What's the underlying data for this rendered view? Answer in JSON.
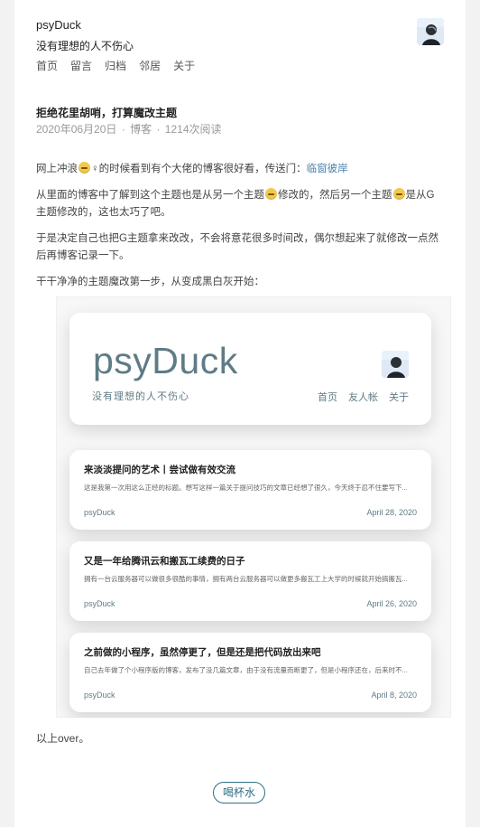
{
  "site": {
    "title": "psyDuck",
    "description": "没有理想的人不伤心",
    "nav": [
      "首页",
      "留言",
      "归档",
      "邻居",
      "关于"
    ]
  },
  "post": {
    "title": "拒绝花里胡哨，打算魔改主题",
    "date": "2020年06月20日",
    "category": "博客",
    "views": "1214次阅读",
    "paragraphs": {
      "p1_before": "网上冲浪",
      "p1_after": "♀的时候看到有个大佬的博客很好看，传送门：",
      "p1_link": "临窗彼岸",
      "p2_a": "从里面的博客中了解到这个主题也是从另一个主题",
      "p2_b": "修改的，然后另一个主题",
      "p2_c": "是从G主题修改的，这也太巧了吧。",
      "p3": "于是决定自己也把G主题拿来改改，不会将意花很多时间改，偶尔想起来了就修改一点然后再博客记录一下。",
      "p4": "干干净净的主题魔改第一步，从变成黑白灰开始："
    },
    "screenshot": {
      "logo": "psyDuck",
      "tagline": "没有理想的人不伤心",
      "nav": [
        "首页",
        "友人帐",
        "关于"
      ],
      "articles": [
        {
          "title": "来淡淡提问的艺术丨尝试做有效交流",
          "excerpt": "这是我第一次用这么正经的标题。想写这样一篇关于提问技巧的文章已经想了很久，今天终于忍不住要写下...",
          "author": "psyDuck",
          "date": "April 28, 2020"
        },
        {
          "title": "又是一年给腾讯云和搬瓦工续费的日子",
          "excerpt": "拥有一台云服务器可以做很多很酷的事情，拥有两台云服务器可以做更多搬瓦工上大学的时候就开始搞搬瓦...",
          "author": "psyDuck",
          "date": "April 26, 2020"
        },
        {
          "title": "之前做的小程序，虽然停更了，但是还是把代码放出来吧",
          "excerpt": "自己去年做了个小程序版的博客，发布了没几篇文章，由于没有流量而断更了，但是小程序还在，后来时不...",
          "author": "psyDuck",
          "date": "April 8, 2020"
        }
      ]
    },
    "after": "以上over。"
  },
  "tip_button": "喝杯水",
  "icons": {
    "avatar": "avatar-icon",
    "emoji": "grinning-emoji-icon"
  }
}
